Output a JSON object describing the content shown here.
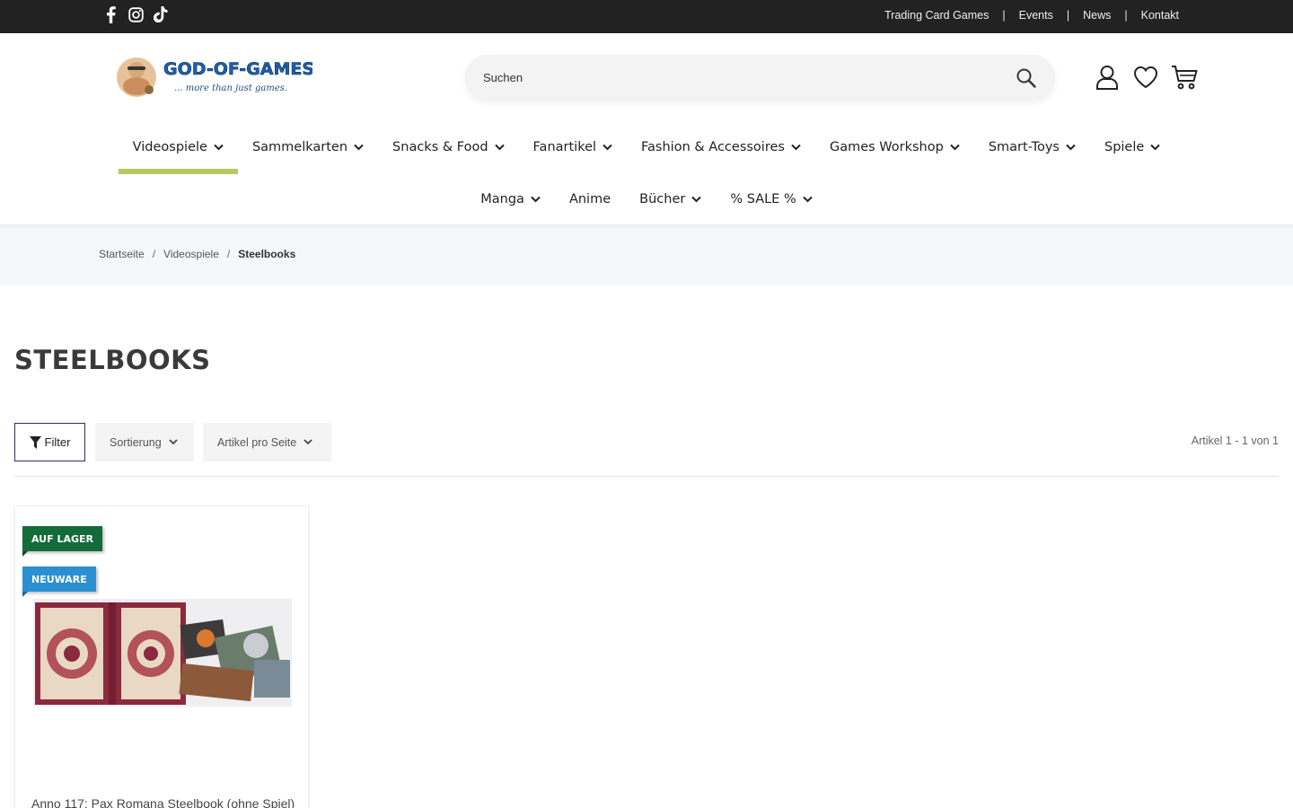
{
  "topbar": {
    "social": [
      "facebook-icon",
      "instagram-icon",
      "tiktok-icon"
    ],
    "links": [
      "Trading Card Games",
      "Events",
      "News",
      "Kontakt"
    ]
  },
  "header": {
    "logo_text": "GOD-OF-GAMES.DE",
    "logo_tagline": "... more than just games.",
    "search_placeholder": "Suchen",
    "icons": [
      "account-icon",
      "wishlist-heart-icon",
      "cart-icon"
    ]
  },
  "nav": {
    "row1": [
      {
        "label": "Videospiele",
        "dropdown": true,
        "active": true
      },
      {
        "label": "Sammelkarten",
        "dropdown": true
      },
      {
        "label": "Snacks & Food",
        "dropdown": true
      },
      {
        "label": "Fanartikel",
        "dropdown": true
      },
      {
        "label": "Fashion & Accessoires",
        "dropdown": true
      },
      {
        "label": "Games Workshop",
        "dropdown": true
      },
      {
        "label": "Smart-Toys",
        "dropdown": true
      },
      {
        "label": "Spiele",
        "dropdown": true
      }
    ],
    "row2": [
      {
        "label": "Manga",
        "dropdown": true
      },
      {
        "label": "Anime",
        "dropdown": false
      },
      {
        "label": "Bücher",
        "dropdown": true
      },
      {
        "label": "% SALE %",
        "dropdown": true
      }
    ],
    "active_color": "#b4c95e"
  },
  "breadcrumb": {
    "items": [
      "Startseite",
      "Videospiele",
      "Steelbooks"
    ]
  },
  "page": {
    "title": "STEELBOOKS"
  },
  "toolbar": {
    "filter_label": "Filter",
    "sort_label": "Sortierung",
    "perpage_label": "Artikel pro Seite",
    "count_text": "Artikel 1 - 1 von 1"
  },
  "products": [
    {
      "badges": [
        "AUF LAGER",
        "NEUWARE"
      ],
      "name": "Anno 117: Pax Romana Steelbook (ohne Spiel)"
    }
  ],
  "colors": {
    "topbar": "#222222",
    "badge_stock": "#146b3a",
    "badge_new": "#2c8fd1",
    "breadcrumb_bg": "#f5f7fa"
  }
}
